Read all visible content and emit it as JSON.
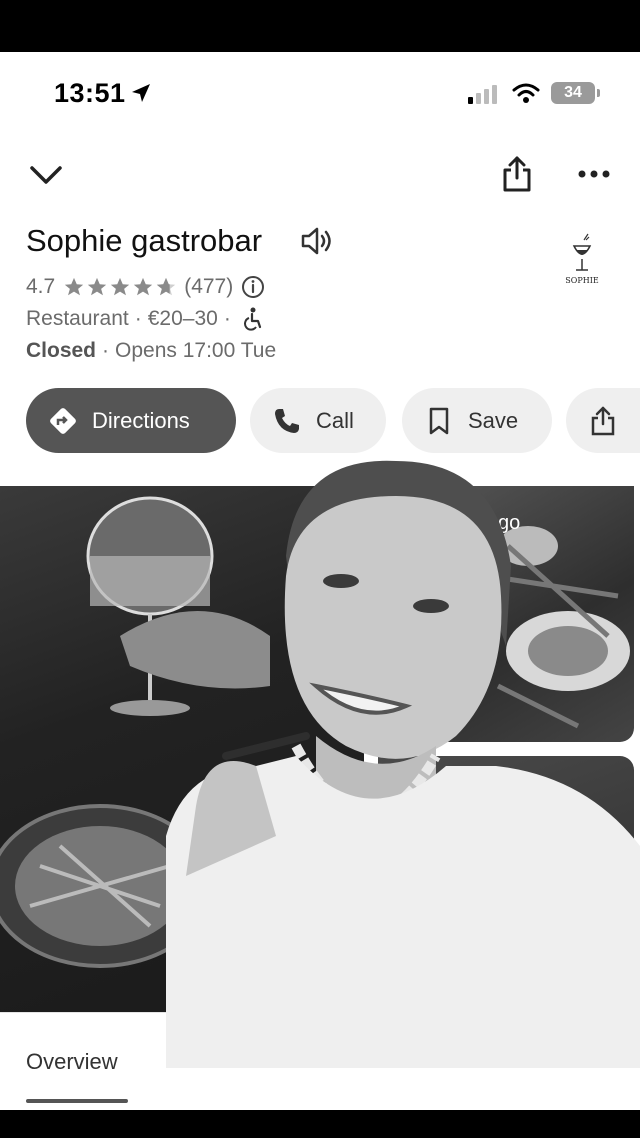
{
  "status_bar": {
    "time": "13:51",
    "battery": "34"
  },
  "header": {
    "back_icon": "chevron-down-icon",
    "share_icon": "share-icon",
    "more_icon": "more-horizontal-icon"
  },
  "place": {
    "name": "Sophie gastrobar",
    "rating": "4.7",
    "rating_stars": 4.7,
    "review_count": "(477)",
    "category": "Restaurant",
    "price": "€20–30",
    "status": "Closed",
    "opens": "Opens 17:00 Tue",
    "logo_text": "SOPHIE"
  },
  "actions": {
    "directions": "Directions",
    "call": "Call",
    "save": "Save"
  },
  "photos": {
    "top_right_label": "go"
  },
  "tabs": {
    "overview": "Overview"
  },
  "colors": {
    "button_dark": "#555555",
    "button_light": "#efefef",
    "text_gray": "#6b6b6b"
  }
}
